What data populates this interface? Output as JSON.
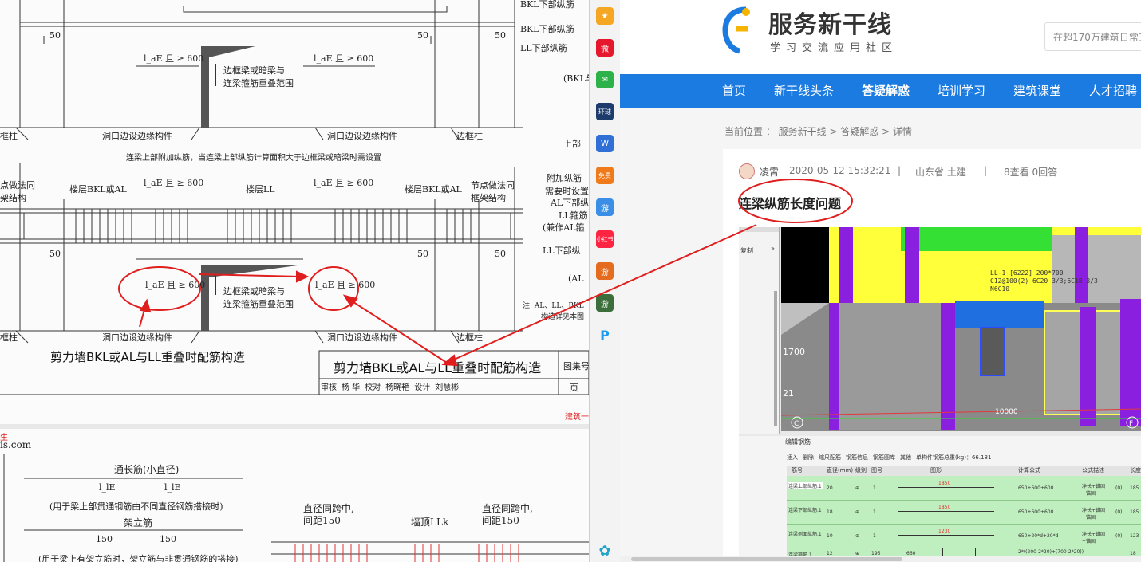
{
  "drawing": {
    "top_labels": {
      "bkl_bottom": "BKL下部纵筋",
      "ll_bottom": "LL下部纵筋",
      "bkl_or": "(BKL与",
      "upper": "上部",
      "dim_50": "50",
      "lae_600": "l_aE 且 ≥ 600",
      "overlap_range": "边框梁或暗梁与",
      "overlap_range2": "连梁箍筋重叠范围",
      "frame_col": "框柱",
      "opening_member": "洞口边设边缘构件",
      "side_col": "边框柱"
    },
    "note_top": "连梁上部附加纵筋，当连梁上部纵筋计算面积大于边框梁或暗梁时需设置",
    "mid_labels": {
      "node_same": "点做法同",
      "frame_struct": "架结构",
      "floor_bkl": "楼层BKL或AL",
      "floor_ll": "楼层LL",
      "node_same2": "节点做法同",
      "frame_struct2": "框架结构",
      "add_long": "附加纵筋",
      "need_set": "需要时设置",
      "al_bottom": "AL下部纵",
      "ll_stirrup": "LL箍筋",
      "also_al": "(兼作AL箍",
      "ll_bottom2": "LL下部纵",
      "al_paren": "(AL",
      "note": "注: AL、LL、BKL",
      "note2": "构造详见本图"
    },
    "title_under": "剪力墙BKL或AL与LL重叠时配筋构造",
    "title_block": "剪力墙BKL或AL与LL重叠时配筋构造",
    "atlas_no": "图集号",
    "page_label": "页",
    "sign_row": [
      "审核",
      "杨  华",
      "校对",
      "杨晓艳",
      "设计",
      "刘慧彬"
    ],
    "footer_red": "建筑一",
    "bottom_red": "生",
    "bottom_url": "is.com",
    "bottom": {
      "through": "通长筋(小直径)",
      "lle1": "l_lE",
      "lle2": "l_lE",
      "through_note": "(用于梁上部贯通钢筋由不同直径钢筋搭接时)",
      "erect": "架立筋",
      "d150a": "150",
      "d150b": "150",
      "erect_note": "(用于梁上有架立筋时，架立筋与非贯通钢筋的搭接)",
      "same_span1": "直径同跨中,",
      "spacing1": "间距150",
      "wall_top": "墙顶LLk",
      "same_span2": "直径同跨中,",
      "spacing2": "间距150"
    },
    "colors": {
      "annotation": "#e01e1e"
    }
  },
  "sidebar": {
    "items": [
      {
        "icon": "star-icon",
        "label": "★",
        "color": "#f5a623"
      },
      {
        "icon": "weibo-icon",
        "label": "微",
        "color": "#e6162d"
      },
      {
        "icon": "mail-icon",
        "label": "✉",
        "color": "#2db24a"
      },
      {
        "icon": "news-icon",
        "label": "环球",
        "color": "#1d3b6b"
      },
      {
        "icon": "doc-icon",
        "label": "W",
        "color": "#2f6fd6"
      },
      {
        "icon": "novel-icon",
        "label": "免费",
        "color": "#f07a1a"
      },
      {
        "icon": "game-icon",
        "label": "游",
        "color": "#3a8ee6"
      },
      {
        "icon": "redbook-icon",
        "label": "小红书",
        "color": "#ff2442"
      },
      {
        "icon": "game2-icon",
        "label": "游",
        "color": "#e56b1f"
      },
      {
        "icon": "game3-icon",
        "label": "游",
        "color": "#3c6e3c"
      },
      {
        "icon": "p-icon",
        "label": "P",
        "color": "#1e9bf0"
      }
    ],
    "bottom_icon": {
      "icon": "flower-icon",
      "label": "✿"
    }
  },
  "web": {
    "logo_title": "服务新干线",
    "logo_sub": "学习交流应用社区",
    "search_placeholder": "在超170万建筑日常工",
    "nav": [
      "首页",
      "新干线头条",
      "答疑解惑",
      "培训学习",
      "建筑课堂",
      "人才招聘"
    ],
    "nav_active_index": 2,
    "breadcrumb": "当前位置 ： 服务新干线 > 答疑解惑 > 详情",
    "author": "凌霄",
    "date": "2020-05-12 15:32:21",
    "sep1": "|",
    "region": "山东省  土建",
    "sep2": "|",
    "stats": "8查看  0回答",
    "question_title": "连梁纵筋长度问题",
    "brand_color": "#1b7be0"
  },
  "software": {
    "left_labels": [
      "复制",
      "»"
    ],
    "model_text": [
      "LL-1 [6222] 200*700",
      "C12@100(2) 6C20 3/3;6C18 3/3",
      "N6C10"
    ],
    "axis_labels": [
      "1700",
      "21",
      "C",
      "F"
    ],
    "dim_label": "10000",
    "panel_title": "编辑钢筋",
    "toolbar": [
      "插入",
      "删除",
      "缩尺配筋",
      "钢筋信息",
      "钢筋图库",
      "其他",
      "单构件钢筋总重(kg)：66.181"
    ],
    "columns": [
      "筋号",
      "直径(mm)",
      "级别",
      "图号",
      "图形",
      "计算公式",
      "公式描述",
      "长度"
    ],
    "rows": [
      {
        "name": "连梁上部纵筋.1",
        "dia": "20",
        "grade": "⊕",
        "fig": "1",
        "len": "1850",
        "formula": "650+600+600",
        "desc": "净长+锚固+锚固",
        "n": "(0)",
        "total": "185"
      },
      {
        "name": "连梁下部纵筋.1",
        "dia": "18",
        "grade": "⊕",
        "fig": "1",
        "len": "1850",
        "formula": "650+600+600",
        "desc": "净长+锚固+锚固",
        "n": "(0)",
        "total": "185"
      },
      {
        "name": "连梁侧面纵筋.1",
        "dia": "10",
        "grade": "⊕",
        "fig": "1",
        "len": "1230",
        "formula": "650+20*d+20*d",
        "desc": "净长+锚固+锚固",
        "n": "(0)",
        "total": "123"
      },
      {
        "name": "连梁箍筋.1",
        "dia": "12",
        "grade": "⊕",
        "fig": "195",
        "len": "660",
        "formula": "2*((200-2*20)+(700-2*20))",
        "desc": "",
        "n": "",
        "total": "18"
      }
    ]
  }
}
